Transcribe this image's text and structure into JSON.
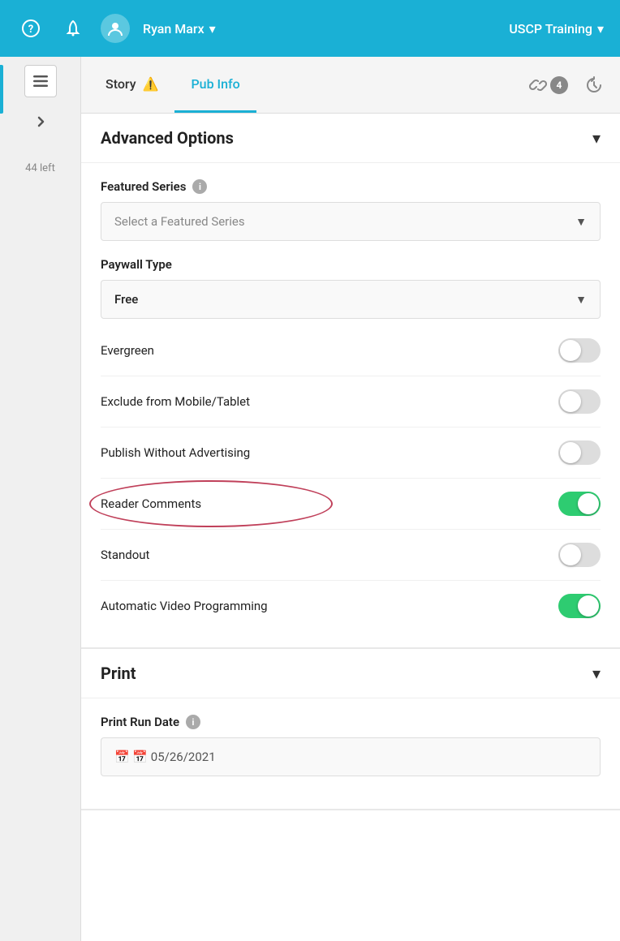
{
  "topbar": {
    "help_icon": "?",
    "bell_icon": "🔔",
    "avatar_icon": "👤",
    "user_name": "Ryan Marx",
    "user_dropdown": "▾",
    "org_name": "USCP Training",
    "org_dropdown": "▾"
  },
  "sidebar": {
    "count_label": "44 left"
  },
  "tabs": [
    {
      "id": "story",
      "label": "Story",
      "warning": "⚠️",
      "active": false
    },
    {
      "id": "pub_info",
      "label": "Pub Info",
      "active": true
    }
  ],
  "tab_icons": [
    {
      "id": "link",
      "symbol": "🔗",
      "badge": "4"
    },
    {
      "id": "history",
      "symbol": "↺"
    }
  ],
  "advanced_options": {
    "section_title": "Advanced Options",
    "chevron": "▾",
    "featured_series": {
      "label": "Featured Series",
      "placeholder": "Select a Featured Series"
    },
    "paywall_type": {
      "label": "Paywall Type",
      "value": "Free"
    },
    "toggles": [
      {
        "id": "evergreen",
        "label": "Evergreen",
        "on": false,
        "highlighted": false
      },
      {
        "id": "exclude-mobile",
        "label": "Exclude from Mobile/Tablet",
        "on": false,
        "highlighted": false
      },
      {
        "id": "publish-no-ads",
        "label": "Publish Without Advertising",
        "on": false,
        "highlighted": false
      },
      {
        "id": "reader-comments",
        "label": "Reader Comments",
        "on": true,
        "highlighted": true
      },
      {
        "id": "standout",
        "label": "Standout",
        "on": false,
        "highlighted": false
      },
      {
        "id": "auto-video",
        "label": "Automatic Video Programming",
        "on": true,
        "highlighted": false
      }
    ]
  },
  "print_section": {
    "section_title": "Print",
    "chevron": "▾",
    "print_run_date": {
      "label": "Print Run Date",
      "value": "📅 05/26/2021"
    }
  }
}
